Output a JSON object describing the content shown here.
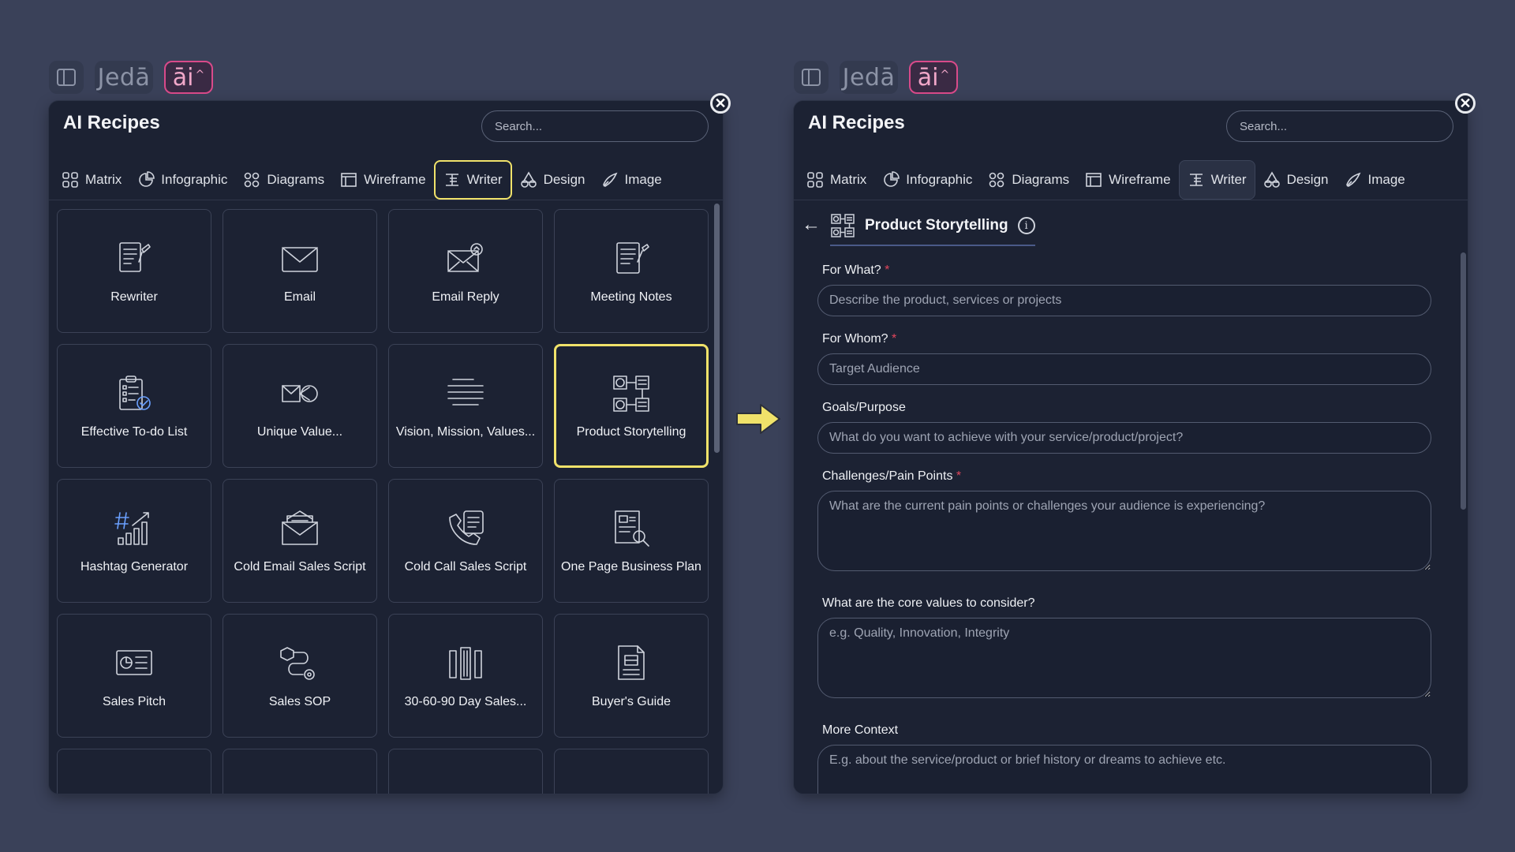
{
  "brand": {
    "jeda_label": "Jedā",
    "ai_label": "āi"
  },
  "title": "AI Recipes",
  "search_placeholder": "Search...",
  "tabs": [
    {
      "label": "Matrix",
      "icon": "matrix-icon"
    },
    {
      "label": "Infographic",
      "icon": "infographic-icon"
    },
    {
      "label": "Diagrams",
      "icon": "diagrams-icon"
    },
    {
      "label": "Wireframe",
      "icon": "wireframe-icon"
    },
    {
      "label": "Writer",
      "icon": "writer-icon"
    },
    {
      "label": "Design",
      "icon": "design-icon"
    },
    {
      "label": "Image",
      "icon": "image-icon"
    }
  ],
  "active_tab": "Writer",
  "cards": [
    {
      "label": "Rewriter",
      "icon": "rewriter-icon"
    },
    {
      "label": "Email",
      "icon": "email-icon"
    },
    {
      "label": "Email Reply",
      "icon": "email-reply-icon"
    },
    {
      "label": "Meeting Notes",
      "icon": "meeting-notes-icon"
    },
    {
      "label": "Effective To-do List",
      "icon": "todo-list-icon"
    },
    {
      "label": "Unique Value...",
      "icon": "unique-value-icon"
    },
    {
      "label": "Vision, Mission, Values...",
      "icon": "vision-lines-icon"
    },
    {
      "label": "Product Storytelling",
      "icon": "product-storytelling-icon",
      "selected": true
    },
    {
      "label": "Hashtag Generator",
      "icon": "hashtag-icon"
    },
    {
      "label": "Cold Email Sales Script",
      "icon": "cold-email-icon"
    },
    {
      "label": "Cold Call Sales Script",
      "icon": "cold-call-icon"
    },
    {
      "label": "One Page Business Plan",
      "icon": "business-plan-icon"
    },
    {
      "label": "Sales Pitch",
      "icon": "sales-pitch-icon"
    },
    {
      "label": "Sales SOP",
      "icon": "sales-sop-icon"
    },
    {
      "label": "30-60-90 Day Sales...",
      "icon": "sales-plan-icon"
    },
    {
      "label": "Buyer's Guide",
      "icon": "buyers-guide-icon"
    }
  ],
  "recipe": {
    "back": "←",
    "title": "Product Storytelling",
    "info": "i",
    "fields": [
      {
        "label": "For What?",
        "required": "*",
        "placeholder": "Describe the product, services or projects",
        "type": "input"
      },
      {
        "label": "For Whom?",
        "required": "*",
        "placeholder": "Target Audience",
        "type": "input"
      },
      {
        "label": "Goals/Purpose",
        "required": "",
        "placeholder": "What do you want to achieve with your service/product/project?",
        "type": "input"
      },
      {
        "label": "Challenges/Pain Points",
        "required": "*",
        "placeholder": "What are the current pain points or challenges your audience is experiencing?",
        "type": "textarea"
      },
      {
        "label": "What are the core values to consider?",
        "required": "",
        "placeholder": "e.g. Quality, Innovation, Integrity",
        "type": "textarea"
      },
      {
        "label": "More Context",
        "required": "",
        "placeholder": "E.g. about the service/product or brief history or dreams to achieve etc.",
        "type": "textarea"
      }
    ]
  },
  "colors": {
    "accent_yellow": "#f0e26a",
    "ai_pink": "#d94a8a",
    "panel_bg": "#1c2233",
    "page_bg": "#3a4159",
    "required_red": "#e0465c"
  }
}
